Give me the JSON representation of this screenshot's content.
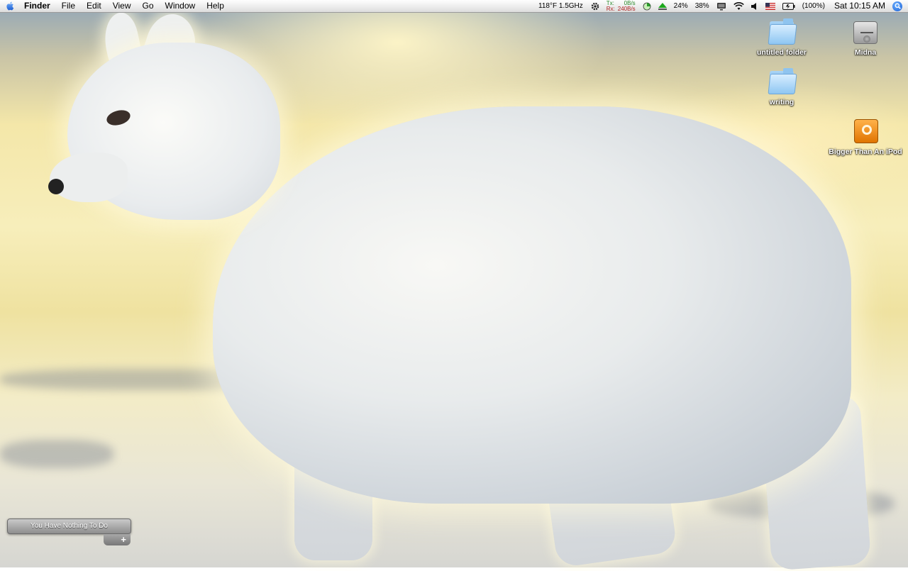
{
  "menubar": {
    "app_name": "Finder",
    "menus": [
      "File",
      "Edit",
      "View",
      "Go",
      "Window",
      "Help"
    ],
    "status": {
      "cpu_temp": "118°F 1.5GHz",
      "tx_label": "Tx:",
      "rx_label": "Rx:",
      "tx_value": "0B/s",
      "rx_value": "240B/s",
      "cpu_percent": "24%",
      "mem_percent": "38%",
      "battery": "(100%)",
      "clock": "Sat 10:15 AM"
    }
  },
  "desktop": {
    "icons": [
      {
        "label": "untitled folder",
        "icon": "folder-icon"
      },
      {
        "label": "Midna",
        "icon": "hard-disk-icon"
      },
      {
        "label": "writing",
        "icon": "folder-icon"
      },
      {
        "label": "Bigger Than An iPod",
        "icon": "ipod-disk-icon"
      }
    ]
  },
  "todo_widget": {
    "text": "You Have Nothing To Do",
    "add_label": "+"
  },
  "colors": {
    "menubar_top": "#fefefe",
    "folder_blue": "#8ec6f2",
    "ipod_orange": "#f08a10",
    "spotlight_blue": "#1a5fd6"
  }
}
